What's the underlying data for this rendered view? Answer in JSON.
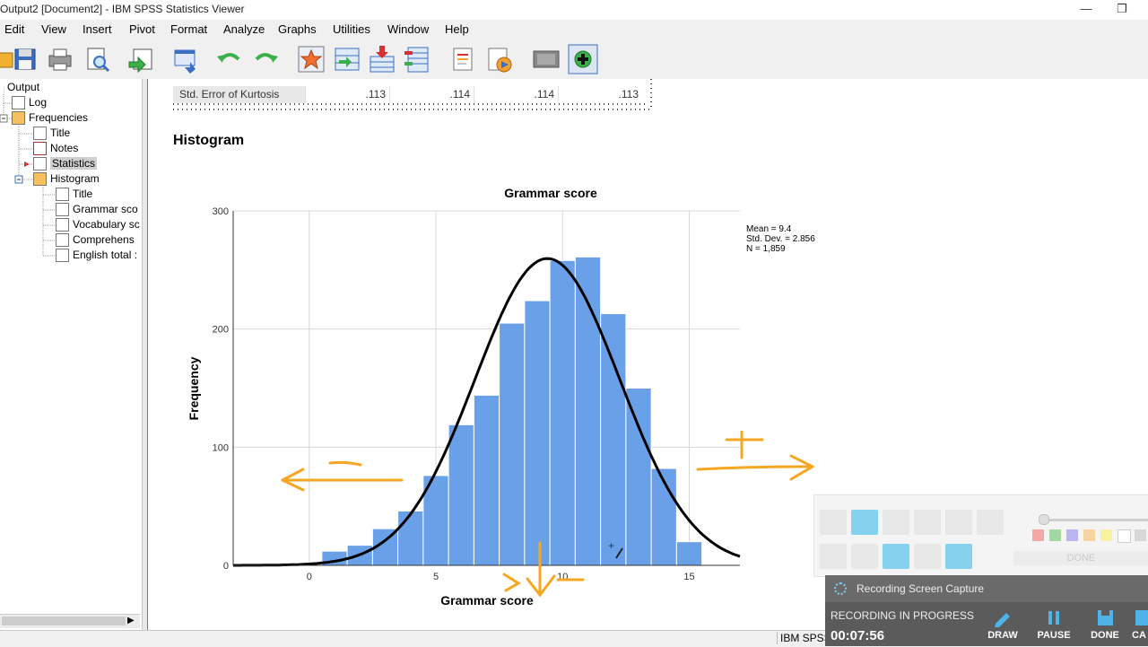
{
  "window": {
    "title": "Output2 [Document2] - IBM SPSS Statistics Viewer",
    "minimize": "—",
    "restore": "❐"
  },
  "menu": [
    "Edit",
    "View",
    "Insert",
    "Pivot",
    "Format",
    "Analyze",
    "Graphs",
    "Utilities",
    "Window",
    "Help"
  ],
  "toolbar_icons": [
    "open-icon",
    "save-icon",
    "print-icon",
    "print-preview-icon",
    "export-icon",
    "recall-dialog-icon",
    "undo-icon",
    "redo-icon",
    "goto-data-icon",
    "goto-case-icon",
    "goto-variable-icon",
    "variables-icon",
    "create-title-icon",
    "script-icon",
    "hide-icon",
    "insert-icon"
  ],
  "nav": {
    "items": [
      {
        "label": "Output",
        "icon": "folder-icon"
      },
      {
        "label": "Log",
        "icon": "log-icon"
      },
      {
        "label": "Frequencies",
        "icon": "procedure-icon"
      },
      {
        "label": "Title",
        "icon": "title-icon"
      },
      {
        "label": "Notes",
        "icon": "notes-icon"
      },
      {
        "label": "Statistics",
        "icon": "table-icon"
      },
      {
        "label": "Histogram",
        "icon": "procedure-icon"
      },
      {
        "label": "Title",
        "icon": "title-icon"
      },
      {
        "label": "Grammar sco",
        "icon": "chart-icon"
      },
      {
        "label": "Vocabulary sc",
        "icon": "chart-icon"
      },
      {
        "label": "Comprehens",
        "icon": "chart-icon"
      },
      {
        "label": "English total :",
        "icon": "chart-icon"
      }
    ]
  },
  "stats_row": {
    "label": "Std. Error of Kurtosis",
    "values": [
      ".113",
      ".114",
      ".114",
      ".113"
    ]
  },
  "heading": "Histogram",
  "chart_data": {
    "type": "bar",
    "title": "Grammar score",
    "xlabel": "Grammar score",
    "ylabel": "Frequency",
    "xlim": [
      -3,
      17
    ],
    "ylim": [
      0,
      300
    ],
    "x_ticks": [
      "0",
      "5",
      "10",
      "15"
    ],
    "y_ticks": [
      "0",
      "100",
      "200",
      "300"
    ],
    "bins": [
      {
        "x": 1,
        "value": 12
      },
      {
        "x": 2,
        "value": 17
      },
      {
        "x": 3,
        "value": 31
      },
      {
        "x": 4,
        "value": 46
      },
      {
        "x": 5,
        "value": 76
      },
      {
        "x": 6,
        "value": 119
      },
      {
        "x": 7,
        "value": 144
      },
      {
        "x": 8,
        "value": 205
      },
      {
        "x": 9,
        "value": 224
      },
      {
        "x": 10,
        "value": 258
      },
      {
        "x": 11,
        "value": 261
      },
      {
        "x": 12,
        "value": 213
      },
      {
        "x": 13,
        "value": 150
      },
      {
        "x": 14,
        "value": 82
      },
      {
        "x": 15,
        "value": 20
      }
    ],
    "normal_curve": {
      "mean": 9.4,
      "sd": 2.856,
      "n": 1859
    },
    "legend": [
      "Mean = 9.4",
      "Std. Dev. = 2.856",
      "N = 1,859"
    ],
    "grid": true,
    "bar_color": "#6aa0e8"
  },
  "status": "IBM SPSS",
  "recording": {
    "header": "Recording Screen Capture",
    "state": "RECORDING IN PROGRESS",
    "time": "00:07:56",
    "buttons": [
      "DRAW",
      "PAUSE",
      "DONE",
      "CA"
    ]
  },
  "draw_panel": {
    "done_label": "DONE",
    "colors": [
      "#f4a3a3",
      "#9ed69e",
      "#b6b0f2",
      "#f7d29a",
      "#f7f29a",
      "#ffffff",
      "#d6d6d6"
    ]
  }
}
